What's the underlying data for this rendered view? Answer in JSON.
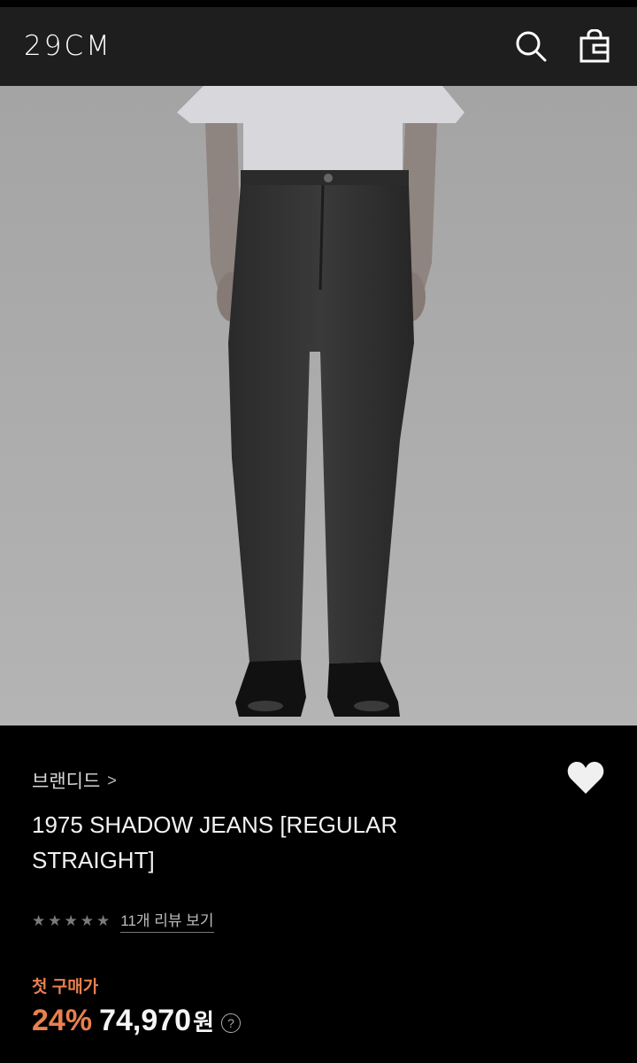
{
  "header": {
    "logo": "29CM",
    "search_icon": "search-icon",
    "bag_icon": "shopping-bag-icon"
  },
  "product_image": {
    "alt": "model wearing dark washed straight jeans with white t-shirt and black shoes"
  },
  "product": {
    "brand": "브랜디드",
    "brand_chevron": ">",
    "title": "1975 SHADOW JEANS [REGULAR STRAIGHT]",
    "wishlist_icon": "heart-icon",
    "rating_stars": 5,
    "review_link": "11개 리뷰 보기",
    "first_purchase_label": "첫 구매가",
    "discount": "24%",
    "price": "74,970",
    "currency": "원",
    "help": "?"
  },
  "colors": {
    "accent": "#e8804f",
    "header_bg": "#1e1e1e",
    "page_bg": "#000000"
  }
}
